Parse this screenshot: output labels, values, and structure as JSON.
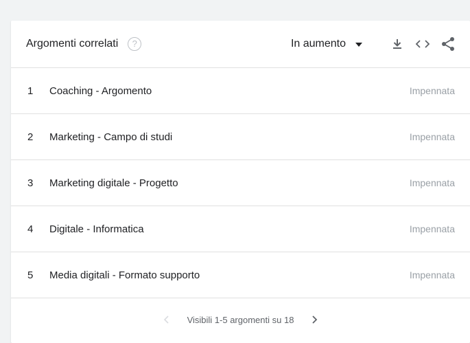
{
  "header": {
    "title": "Argomenti correlati",
    "help_icon": "help-circle-icon",
    "dropdown_label": "In aumento",
    "icons": [
      "download-icon",
      "embed-code-icon",
      "share-icon"
    ]
  },
  "rows": [
    {
      "rank": "1",
      "label": "Coaching - Argomento",
      "value": "Impennata"
    },
    {
      "rank": "2",
      "label": "Marketing - Campo di studi",
      "value": "Impennata"
    },
    {
      "rank": "3",
      "label": "Marketing digitale - Progetto",
      "value": "Impennata"
    },
    {
      "rank": "4",
      "label": "Digitale - Informatica",
      "value": "Impennata"
    },
    {
      "rank": "5",
      "label": "Media digitali - Formato supporto",
      "value": "Impennata"
    }
  ],
  "footer": {
    "pager_text": "Visibili 1-5 argomenti su 18"
  },
  "colors": {
    "text": "#202124",
    "muted": "#9aa0a6",
    "icon": "#5f6368",
    "divider": "#e0e0e0"
  }
}
